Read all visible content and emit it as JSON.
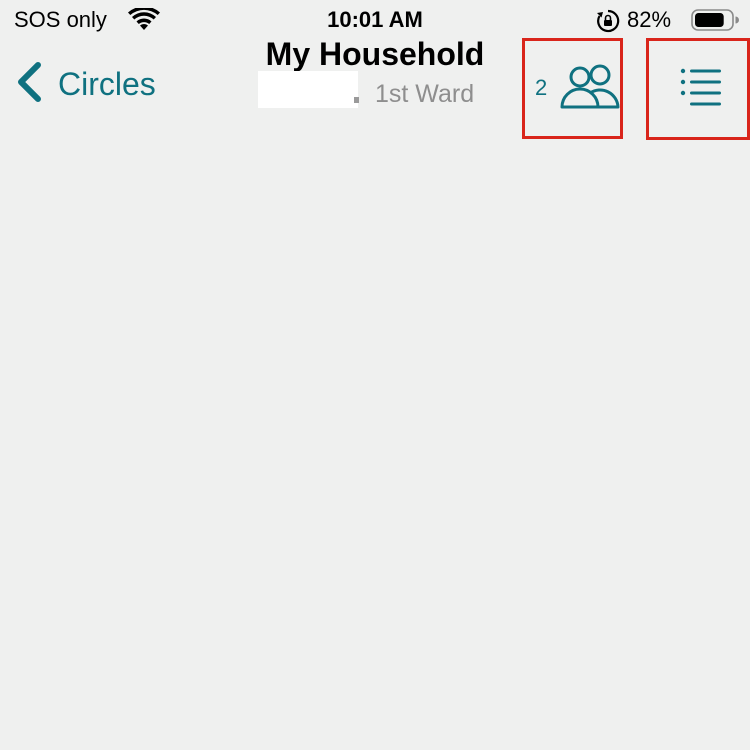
{
  "status_bar": {
    "carrier": "SOS only",
    "time": "10:01 AM",
    "battery_percent": "82%",
    "battery_level": 0.82,
    "icons": [
      "wifi-icon",
      "orientation-lock-icon",
      "battery-icon"
    ]
  },
  "nav": {
    "back_label": "Circles",
    "title": "My Household",
    "subtitle": "1st Ward",
    "member_count": "2",
    "icons": [
      "chevron-left-icon",
      "people-icon",
      "list-menu-icon"
    ]
  },
  "colors": {
    "accent": "#0f7180",
    "background": "#eff0ef",
    "highlight_box": "#d9251b"
  }
}
